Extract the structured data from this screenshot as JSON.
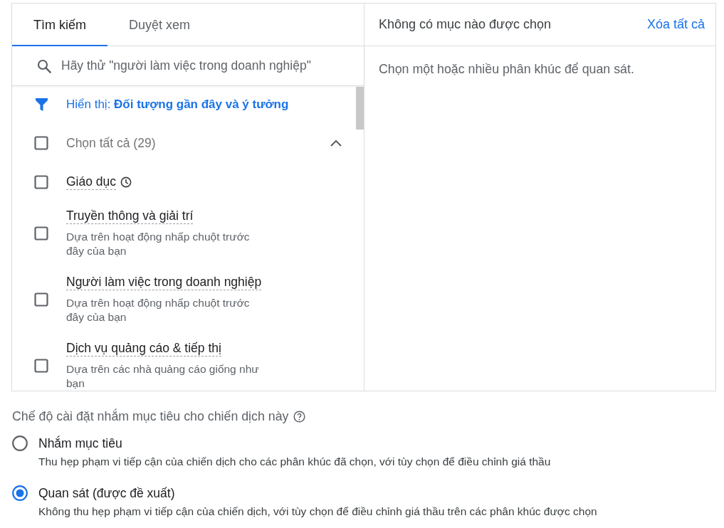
{
  "tabs": [
    {
      "label": "Tìm kiếm",
      "selected": true
    },
    {
      "label": "Duyệt xem",
      "selected": false
    }
  ],
  "search": {
    "placeholder": "Hãy thử \"người làm việc trong doanh nghiệp\""
  },
  "filter": {
    "text": "Hiển thị: **Đối tượng gần đây và ý tưởng**"
  },
  "select_all": {
    "label": "Chọn tất cả (29)",
    "checked": false,
    "expanded": true
  },
  "segments": [
    {
      "title": "Giáo dục",
      "recent": true,
      "checked": false
    },
    {
      "title": "Truyền thông và giải trí",
      "description": "Dựa trên hoạt động nhấp chuột trước đây của bạn",
      "recent": false,
      "checked": false
    },
    {
      "title": "Người làm việc trong doanh nghiệp",
      "description": "Dựa trên hoạt động nhấp chuột trước đây của bạn",
      "recent": false,
      "checked": false
    },
    {
      "title": "Dịch vụ quảng cáo & tiếp thị",
      "description": "Dựa trên các nhà quảng cáo giống như bạn",
      "recent": false,
      "checked": false
    }
  ],
  "selection_panel": {
    "status": "Không có mục nào được chọn",
    "clear_link": "Xóa tất cả",
    "hint": "Chọn một hoặc nhiều phân khúc để quan sát."
  },
  "targeting": {
    "title": "Chế độ cài đặt nhắm mục tiêu cho chiến dịch này",
    "options": [
      {
        "label": "Nhắm mục tiêu",
        "description": "Thu hẹp phạm vi tiếp cận của chiến dịch cho các phân khúc đã chọn, với tùy chọn để điều chỉnh giá thầu",
        "selected": false
      },
      {
        "label": "Quan sát (được đề xuất)",
        "description": "Không thu hẹp phạm vi tiếp cận của chiến dịch, với tùy chọn để điều chỉnh giá thầu trên các phân khúc được chọn",
        "selected": true
      }
    ]
  }
}
